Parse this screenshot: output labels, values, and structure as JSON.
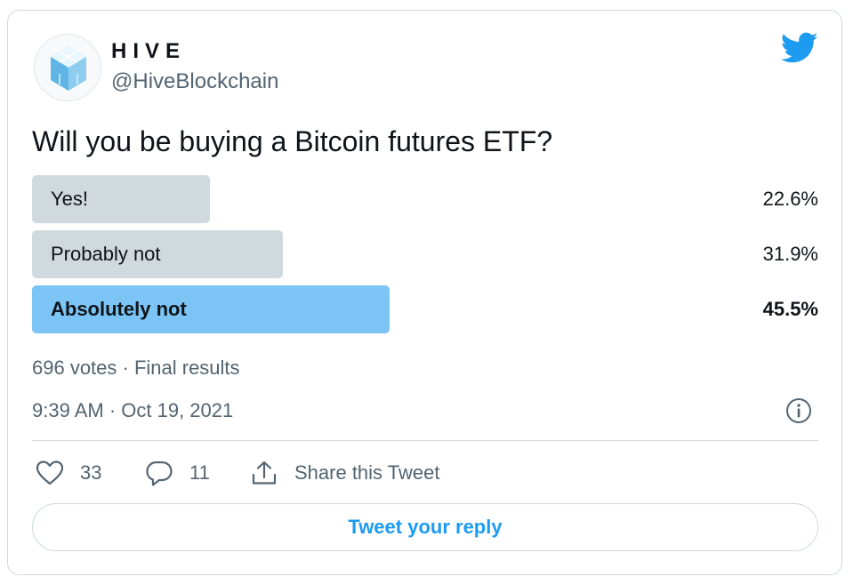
{
  "tweet": {
    "display_name": "HIVE",
    "handle": "@HiveBlockchain",
    "question": "Will you be buying a Bitcoin futures ETF?",
    "brand_color": "#1d9bf0",
    "bird_icon": "twitter-bird-icon",
    "avatar_icon": "hive-cube-logo"
  },
  "poll": {
    "options": [
      {
        "label": "Yes!",
        "percent_text": "22.6%",
        "percent": 22.6,
        "winner": false
      },
      {
        "label": "Probably not",
        "percent_text": "31.9%",
        "percent": 31.9,
        "winner": false
      },
      {
        "label": "Absolutely not",
        "percent_text": "45.5%",
        "percent": 45.5,
        "winner": true
      }
    ],
    "bar_color": "#cfd9de",
    "winner_color": "#7bc4f5",
    "summary": "696 votes · Final results"
  },
  "timestamp": "9:39 AM · Oct 19, 2021",
  "actions": {
    "likes": "33",
    "replies": "11",
    "share_label": "Share this Tweet"
  },
  "reply_button": "Tweet your reply"
}
